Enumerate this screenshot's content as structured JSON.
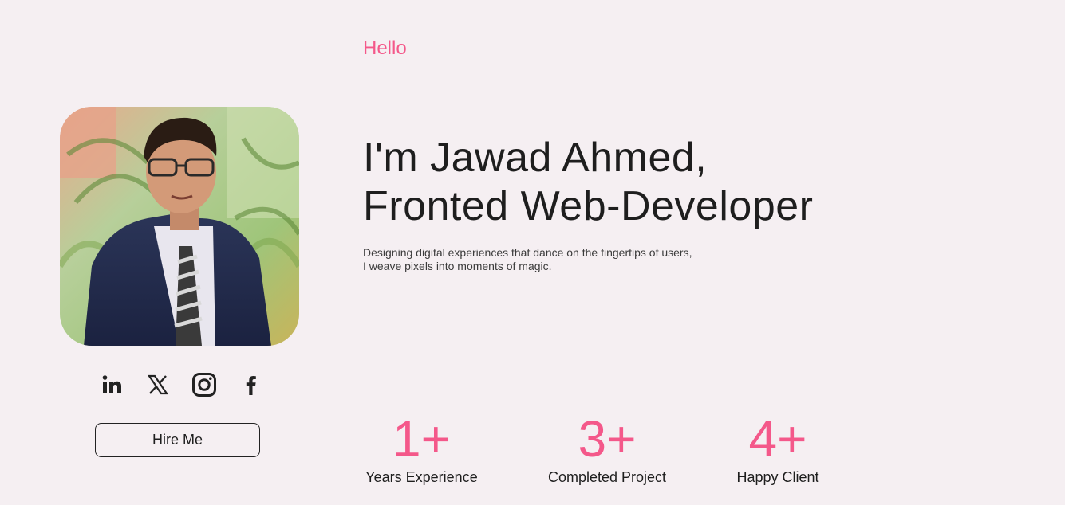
{
  "hero": {
    "greeting": "Hello",
    "headline_line1": "I'm Jawad Ahmed,",
    "headline_line2": "Fronted Web-Developer",
    "tagline_line1": "Designing digital experiences that dance on the fingertips of users,",
    "tagline_line2": "I weave pixels into moments of magic."
  },
  "profile": {
    "photo_alt": "Jawad Ahmed",
    "hire_label": "Hire Me"
  },
  "socials": [
    {
      "icon": "linkedin-icon"
    },
    {
      "icon": "x-twitter-icon"
    },
    {
      "icon": "instagram-icon"
    },
    {
      "icon": "facebook-icon"
    }
  ],
  "stats": [
    {
      "value": "1+",
      "label": "Years Experience"
    },
    {
      "value": "3+",
      "label": "Completed Project"
    },
    {
      "value": "4+",
      "label": "Happy Client"
    }
  ],
  "colors": {
    "accent": "#f4588a",
    "background": "#f5eff2",
    "text": "#1e1e1e"
  }
}
